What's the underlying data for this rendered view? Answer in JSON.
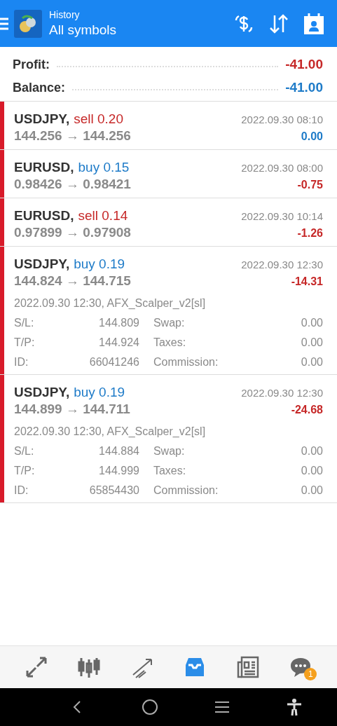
{
  "header": {
    "subtitle": "History",
    "title": "All symbols"
  },
  "summary": [
    {
      "label": "Profit:",
      "value": "-41.00",
      "loss": true
    },
    {
      "label": "Balance:",
      "value": "-41.00",
      "loss": false
    }
  ],
  "trades": [
    {
      "symbol": "USDJPY,",
      "side": "sell",
      "lot": "0.20",
      "prices": "144.256 → 144.256",
      "time": "2022.09.30 08:10",
      "profit": "0.00",
      "loss": false
    },
    {
      "symbol": "EURUSD,",
      "side": "buy",
      "lot": "0.15",
      "prices": "0.98426 → 0.98421",
      "time": "2022.09.30 08:00",
      "profit": "-0.75",
      "loss": true
    },
    {
      "symbol": "EURUSD,",
      "side": "sell",
      "lot": "0.14",
      "prices": "0.97899 → 0.97908",
      "time": "2022.09.30 10:14",
      "profit": "-1.26",
      "loss": true
    },
    {
      "symbol": "USDJPY,",
      "side": "buy",
      "lot": "0.19",
      "prices": "144.824 → 144.715",
      "time": "2022.09.30 12:30",
      "profit": "-14.31",
      "loss": true,
      "comment": "2022.09.30 12:30, AFX_Scalper_v2[sl]",
      "details": [
        [
          "S/L:",
          "144.809",
          "Swap:",
          "0.00"
        ],
        [
          "T/P:",
          "144.924",
          "Taxes:",
          "0.00"
        ],
        [
          "ID:",
          "66041246",
          "Commission:",
          "0.00"
        ]
      ]
    },
    {
      "symbol": "USDJPY,",
      "side": "buy",
      "lot": "0.19",
      "prices": "144.899 → 144.711",
      "time": "2022.09.30 12:30",
      "profit": "-24.68",
      "loss": true,
      "comment": "2022.09.30 12:30, AFX_Scalper_v2[sl]",
      "details": [
        [
          "S/L:",
          "144.884",
          "Swap:",
          "0.00"
        ],
        [
          "T/P:",
          "144.999",
          "Taxes:",
          "0.00"
        ],
        [
          "ID:",
          "65854430",
          "Commission:",
          "0.00"
        ]
      ]
    }
  ],
  "tabs": [
    {
      "kind": "quotes",
      "selected": false
    },
    {
      "kind": "chart",
      "selected": false
    },
    {
      "kind": "trade",
      "selected": false
    },
    {
      "kind": "history",
      "selected": true
    },
    {
      "kind": "news",
      "selected": false
    },
    {
      "kind": "chat",
      "selected": false,
      "badge": "1"
    }
  ]
}
